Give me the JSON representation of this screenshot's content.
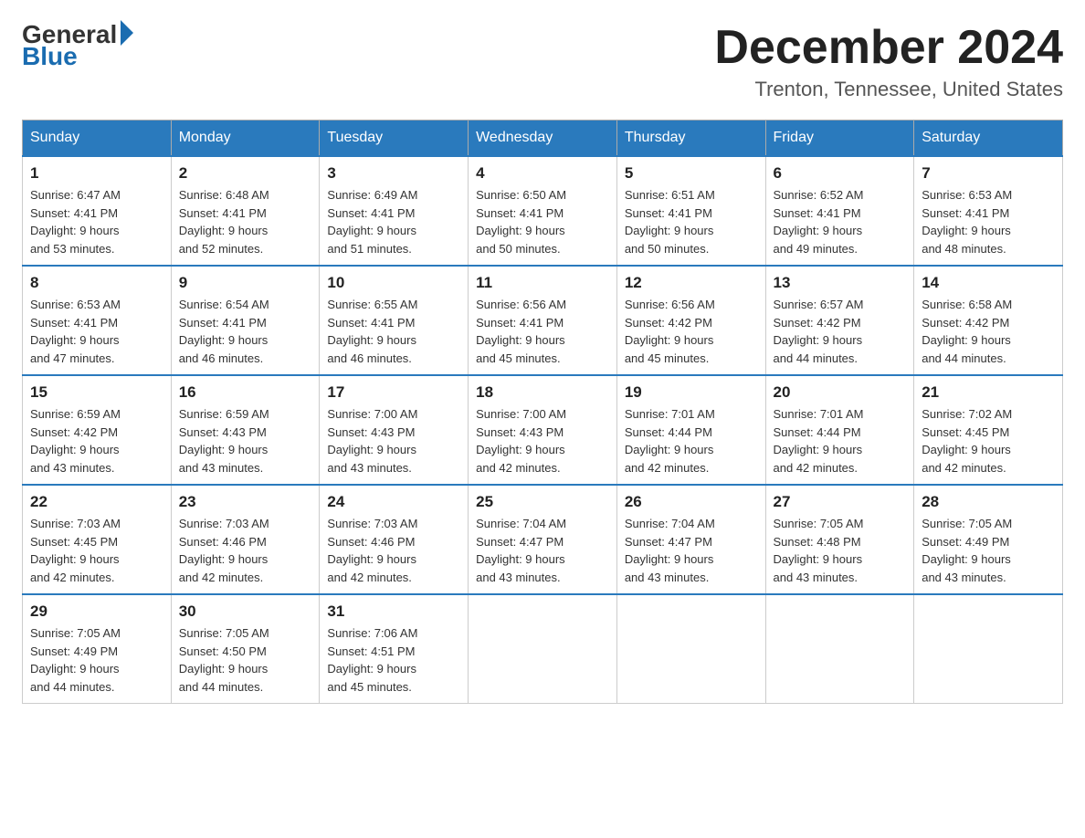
{
  "header": {
    "logo_general": "General",
    "logo_blue": "Blue",
    "month_year": "December 2024",
    "location": "Trenton, Tennessee, United States"
  },
  "days_of_week": [
    "Sunday",
    "Monday",
    "Tuesday",
    "Wednesday",
    "Thursday",
    "Friday",
    "Saturday"
  ],
  "weeks": [
    [
      {
        "day": "1",
        "sunrise": "6:47 AM",
        "sunset": "4:41 PM",
        "daylight": "9 hours and 53 minutes."
      },
      {
        "day": "2",
        "sunrise": "6:48 AM",
        "sunset": "4:41 PM",
        "daylight": "9 hours and 52 minutes."
      },
      {
        "day": "3",
        "sunrise": "6:49 AM",
        "sunset": "4:41 PM",
        "daylight": "9 hours and 51 minutes."
      },
      {
        "day": "4",
        "sunrise": "6:50 AM",
        "sunset": "4:41 PM",
        "daylight": "9 hours and 50 minutes."
      },
      {
        "day": "5",
        "sunrise": "6:51 AM",
        "sunset": "4:41 PM",
        "daylight": "9 hours and 50 minutes."
      },
      {
        "day": "6",
        "sunrise": "6:52 AM",
        "sunset": "4:41 PM",
        "daylight": "9 hours and 49 minutes."
      },
      {
        "day": "7",
        "sunrise": "6:53 AM",
        "sunset": "4:41 PM",
        "daylight": "9 hours and 48 minutes."
      }
    ],
    [
      {
        "day": "8",
        "sunrise": "6:53 AM",
        "sunset": "4:41 PM",
        "daylight": "9 hours and 47 minutes."
      },
      {
        "day": "9",
        "sunrise": "6:54 AM",
        "sunset": "4:41 PM",
        "daylight": "9 hours and 46 minutes."
      },
      {
        "day": "10",
        "sunrise": "6:55 AM",
        "sunset": "4:41 PM",
        "daylight": "9 hours and 46 minutes."
      },
      {
        "day": "11",
        "sunrise": "6:56 AM",
        "sunset": "4:41 PM",
        "daylight": "9 hours and 45 minutes."
      },
      {
        "day": "12",
        "sunrise": "6:56 AM",
        "sunset": "4:42 PM",
        "daylight": "9 hours and 45 minutes."
      },
      {
        "day": "13",
        "sunrise": "6:57 AM",
        "sunset": "4:42 PM",
        "daylight": "9 hours and 44 minutes."
      },
      {
        "day": "14",
        "sunrise": "6:58 AM",
        "sunset": "4:42 PM",
        "daylight": "9 hours and 44 minutes."
      }
    ],
    [
      {
        "day": "15",
        "sunrise": "6:59 AM",
        "sunset": "4:42 PM",
        "daylight": "9 hours and 43 minutes."
      },
      {
        "day": "16",
        "sunrise": "6:59 AM",
        "sunset": "4:43 PM",
        "daylight": "9 hours and 43 minutes."
      },
      {
        "day": "17",
        "sunrise": "7:00 AM",
        "sunset": "4:43 PM",
        "daylight": "9 hours and 43 minutes."
      },
      {
        "day": "18",
        "sunrise": "7:00 AM",
        "sunset": "4:43 PM",
        "daylight": "9 hours and 42 minutes."
      },
      {
        "day": "19",
        "sunrise": "7:01 AM",
        "sunset": "4:44 PM",
        "daylight": "9 hours and 42 minutes."
      },
      {
        "day": "20",
        "sunrise": "7:01 AM",
        "sunset": "4:44 PM",
        "daylight": "9 hours and 42 minutes."
      },
      {
        "day": "21",
        "sunrise": "7:02 AM",
        "sunset": "4:45 PM",
        "daylight": "9 hours and 42 minutes."
      }
    ],
    [
      {
        "day": "22",
        "sunrise": "7:03 AM",
        "sunset": "4:45 PM",
        "daylight": "9 hours and 42 minutes."
      },
      {
        "day": "23",
        "sunrise": "7:03 AM",
        "sunset": "4:46 PM",
        "daylight": "9 hours and 42 minutes."
      },
      {
        "day": "24",
        "sunrise": "7:03 AM",
        "sunset": "4:46 PM",
        "daylight": "9 hours and 42 minutes."
      },
      {
        "day": "25",
        "sunrise": "7:04 AM",
        "sunset": "4:47 PM",
        "daylight": "9 hours and 43 minutes."
      },
      {
        "day": "26",
        "sunrise": "7:04 AM",
        "sunset": "4:47 PM",
        "daylight": "9 hours and 43 minutes."
      },
      {
        "day": "27",
        "sunrise": "7:05 AM",
        "sunset": "4:48 PM",
        "daylight": "9 hours and 43 minutes."
      },
      {
        "day": "28",
        "sunrise": "7:05 AM",
        "sunset": "4:49 PM",
        "daylight": "9 hours and 43 minutes."
      }
    ],
    [
      {
        "day": "29",
        "sunrise": "7:05 AM",
        "sunset": "4:49 PM",
        "daylight": "9 hours and 44 minutes."
      },
      {
        "day": "30",
        "sunrise": "7:05 AM",
        "sunset": "4:50 PM",
        "daylight": "9 hours and 44 minutes."
      },
      {
        "day": "31",
        "sunrise": "7:06 AM",
        "sunset": "4:51 PM",
        "daylight": "9 hours and 45 minutes."
      },
      null,
      null,
      null,
      null
    ]
  ],
  "labels": {
    "sunrise": "Sunrise:",
    "sunset": "Sunset:",
    "daylight": "Daylight:"
  },
  "colors": {
    "header_bg": "#2a7abd",
    "accent_blue": "#1a6cb0"
  }
}
